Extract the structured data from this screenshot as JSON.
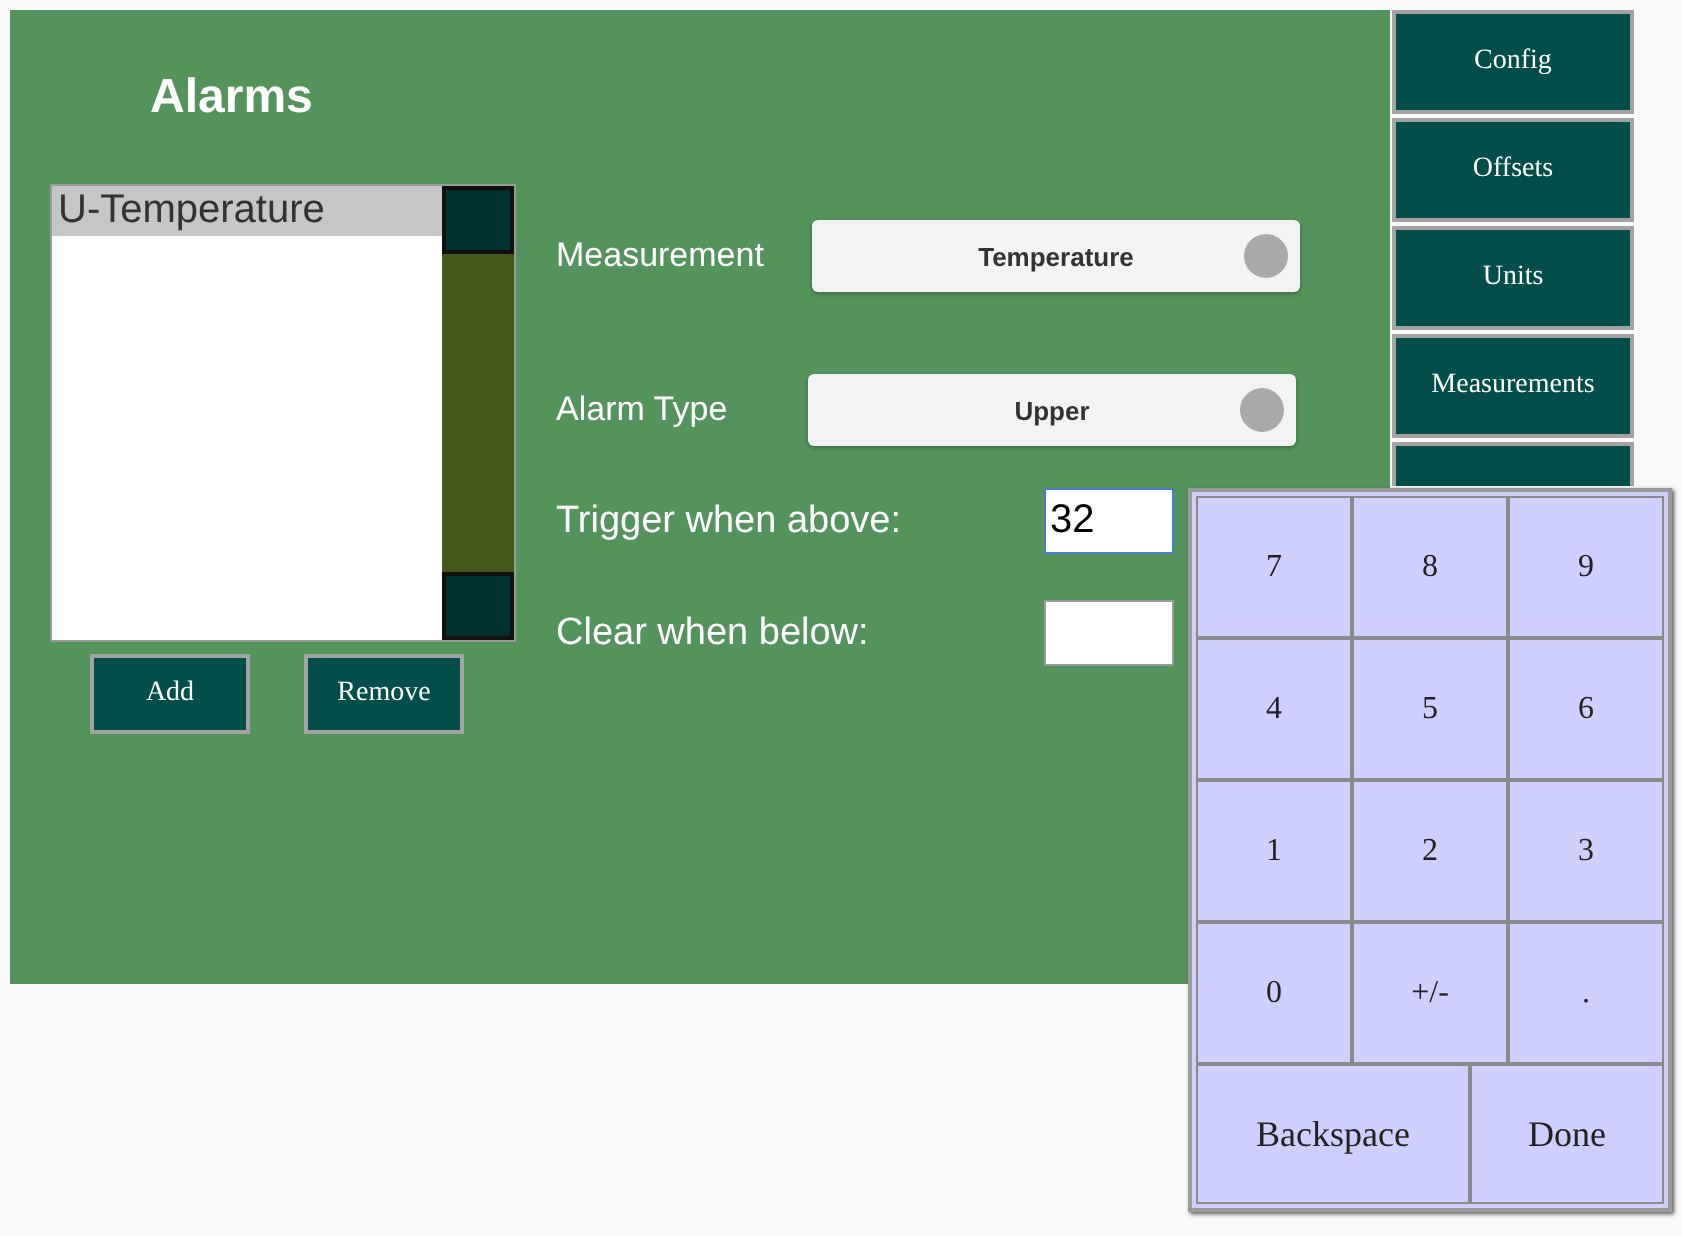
{
  "title": "Alarms",
  "alarm_list": {
    "items": [
      {
        "label": "U-Temperature",
        "selected": true
      }
    ]
  },
  "list_buttons": [
    "Add",
    "Remove"
  ],
  "form": {
    "measurement": {
      "label": "Measurement",
      "value": "Temperature"
    },
    "alarm_type": {
      "label": "Alarm Type",
      "value": "Upper"
    },
    "trigger": {
      "label": "Trigger when above:",
      "value": "32"
    },
    "clear": {
      "label": "Clear when below:"
    }
  },
  "nav_buttons": [
    "Config",
    "Offsets",
    "Units",
    "Measurements"
  ],
  "keypad": {
    "rows": [
      [
        "7",
        "8",
        "9"
      ],
      [
        "4",
        "5",
        "6"
      ],
      [
        "1",
        "2",
        "3"
      ],
      [
        "0",
        "+/-",
        "."
      ]
    ],
    "bottom": [
      "Backspace",
      "Done"
    ]
  }
}
